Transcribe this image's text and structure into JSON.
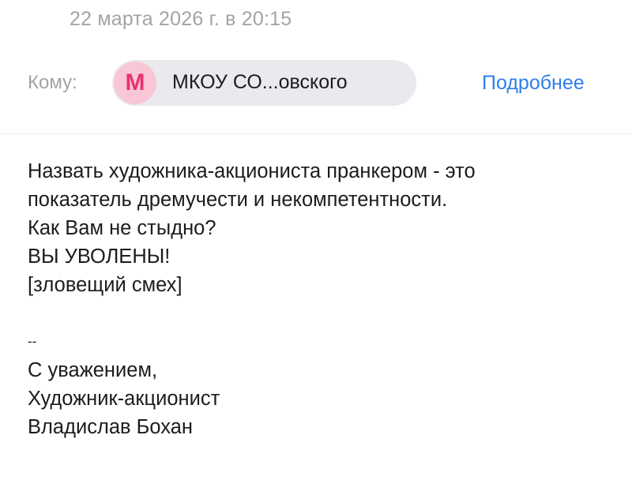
{
  "header": {
    "date": "22 марта 2026 г. в 20:15"
  },
  "recipient": {
    "to_label": "Кому:",
    "avatar_letter": "М",
    "name": "МКОУ СО...овского",
    "details_link": "Подробнее"
  },
  "message": {
    "lines": [
      "Назвать художника-акциониста пранкером - это",
      "показатель дремучести и некомпетентности.",
      "Как Вам не стыдно?",
      "ВЫ УВОЛЕНЫ!",
      "[зловещий смех]"
    ],
    "signature_separator": "--",
    "signature": [
      "С уважением,",
      "Художник-акционист",
      "Владислав Бохан"
    ]
  },
  "colors": {
    "accent_link": "#2f7fe9",
    "avatar_bg": "#f9c6d6",
    "avatar_letter": "#e5336f",
    "chip_bg": "#e9e9ee",
    "muted_text": "#a3a3a8"
  }
}
